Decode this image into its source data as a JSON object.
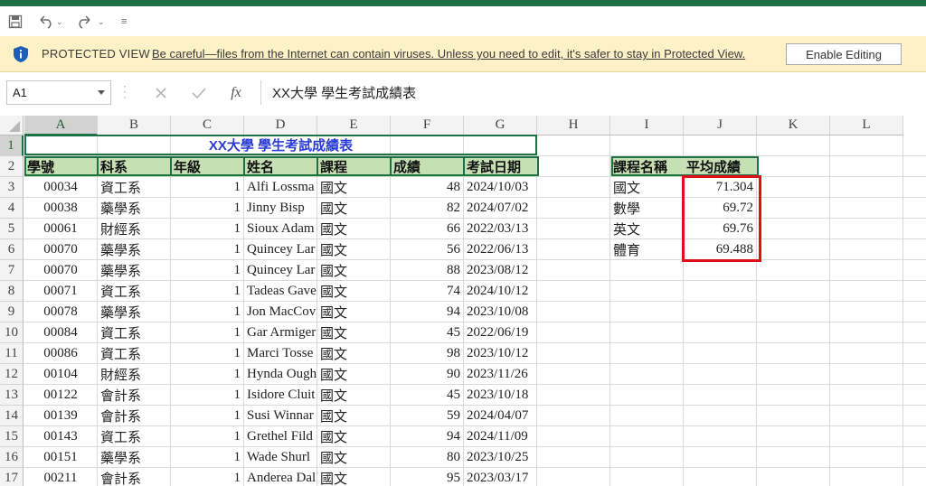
{
  "formula_bar": {
    "name_box": "A1",
    "formula": "XX大學 學生考試成績表",
    "fx_label": "fx"
  },
  "protected_view": {
    "title": "PROTECTED VIEW",
    "message": "Be careful—files from the Internet can contain viruses. Unless you need to edit, it's safer to stay in Protected View.",
    "button": "Enable Editing"
  },
  "columns": [
    "A",
    "B",
    "C",
    "D",
    "E",
    "F",
    "G",
    "H",
    "I",
    "J",
    "K",
    "L"
  ],
  "rows": [
    "1",
    "2",
    "3",
    "4",
    "5",
    "6",
    "7",
    "8",
    "9",
    "10",
    "11",
    "12",
    "13",
    "14",
    "15",
    "16",
    "17"
  ],
  "sheet": {
    "title": "XX大學 學生考試成績表",
    "headers": [
      "學號",
      "科系",
      "年級",
      "姓名",
      "課程",
      "成績",
      "考試日期"
    ],
    "data": [
      [
        "00034",
        "資工系",
        "1",
        "Alfi Lossma",
        "國文",
        "48",
        "2024/10/03"
      ],
      [
        "00038",
        "藥學系",
        "1",
        "Jinny Bisp",
        "國文",
        "82",
        "2024/07/02"
      ],
      [
        "00061",
        "財經系",
        "1",
        "Sioux Adam",
        "國文",
        "66",
        "2022/03/13"
      ],
      [
        "00070",
        "藥學系",
        "1",
        "Quincey Lar",
        "國文",
        "56",
        "2022/06/13"
      ],
      [
        "00070",
        "藥學系",
        "1",
        "Quincey Lar",
        "國文",
        "88",
        "2023/08/12"
      ],
      [
        "00071",
        "資工系",
        "1",
        "Tadeas Gave",
        "國文",
        "74",
        "2024/10/12"
      ],
      [
        "00078",
        "藥學系",
        "1",
        "Jon MacCov",
        "國文",
        "94",
        "2023/10/08"
      ],
      [
        "00084",
        "資工系",
        "1",
        "Gar Armiger",
        "國文",
        "45",
        "2022/06/19"
      ],
      [
        "00086",
        "資工系",
        "1",
        "Marci Tosse",
        "國文",
        "98",
        "2023/10/12"
      ],
      [
        "00104",
        "財經系",
        "1",
        "Hynda Ough",
        "國文",
        "90",
        "2023/11/26"
      ],
      [
        "00122",
        "會計系",
        "1",
        "Isidore Cluit",
        "國文",
        "45",
        "2023/10/18"
      ],
      [
        "00139",
        "會計系",
        "1",
        "Susi Winnar",
        "國文",
        "59",
        "2024/04/07"
      ],
      [
        "00143",
        "資工系",
        "1",
        "Grethel Fild",
        "國文",
        "94",
        "2024/11/09"
      ],
      [
        "00151",
        "藥學系",
        "1",
        "Wade Shurl",
        "國文",
        "80",
        "2023/10/25"
      ],
      [
        "00211",
        "會計系",
        "1",
        "Anderea Dal",
        "國文",
        "95",
        "2023/03/17"
      ]
    ]
  },
  "summary": {
    "headers": [
      "課程名稱",
      "平均成績"
    ],
    "data": [
      [
        "國文",
        "71.304"
      ],
      [
        "數學",
        "69.72"
      ],
      [
        "英文",
        "69.76"
      ],
      [
        "體育",
        "69.488"
      ]
    ]
  },
  "colors": {
    "excel_green": "#1e7145",
    "header_fill": "#c6e0b4",
    "title_text": "#2b3bd6",
    "highlight_red": "#e0101a",
    "protected_banner": "#fdf2c7"
  }
}
